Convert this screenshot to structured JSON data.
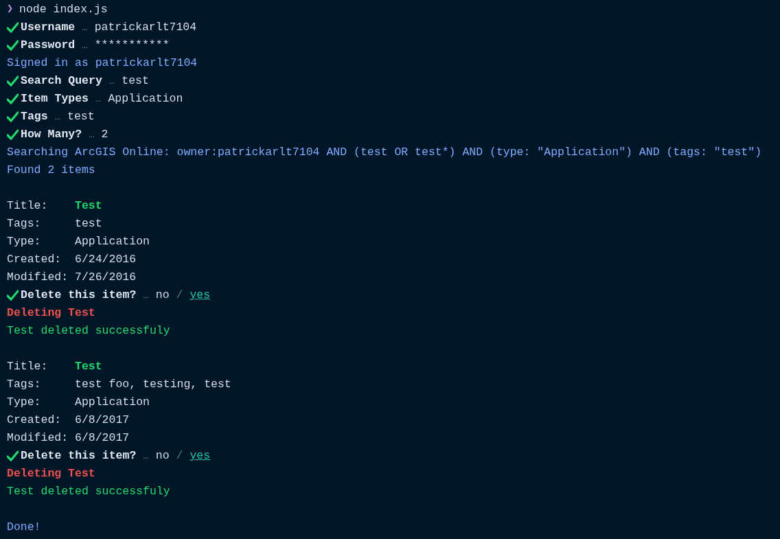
{
  "lines": [
    {
      "kind": "command",
      "prompt": "❯",
      "text": "node index.js"
    },
    {
      "kind": "question",
      "label": "Username",
      "ellipsis": "…",
      "answer": "patrickarlt7104"
    },
    {
      "kind": "question",
      "label": "Password",
      "ellipsis": "…",
      "answer": "***********"
    },
    {
      "kind": "info",
      "text": "Signed in as patrickarlt7104"
    },
    {
      "kind": "question",
      "label": "Search Query",
      "ellipsis": "…",
      "answer": "test"
    },
    {
      "kind": "question",
      "label": "Item Types",
      "ellipsis": "…",
      "answer": "Application"
    },
    {
      "kind": "question",
      "label": "Tags",
      "ellipsis": "…",
      "answer": "test"
    },
    {
      "kind": "question",
      "label": "How Many?",
      "ellipsis": "…",
      "answer": "2"
    },
    {
      "kind": "info",
      "text": "Searching ArcGIS Online: owner:patrickarlt7104 AND (test OR test*) AND (type: \"Application\") AND (tags: \"test\")"
    },
    {
      "kind": "info",
      "text": "Found 2 items"
    },
    {
      "kind": "blank"
    },
    {
      "kind": "field",
      "label": "Title:",
      "value": "Test",
      "highlight": true
    },
    {
      "kind": "field",
      "label": "Tags:",
      "value": "test",
      "highlight": false
    },
    {
      "kind": "field",
      "label": "Type:",
      "value": "Application",
      "highlight": false
    },
    {
      "kind": "field",
      "label": "Created:",
      "value": "6/24/2016",
      "highlight": false
    },
    {
      "kind": "field",
      "label": "Modified:",
      "value": "7/26/2016",
      "highlight": false
    },
    {
      "kind": "choice",
      "label": "Delete this item?",
      "ellipsis": "…",
      "separator": "/",
      "options": [
        {
          "label": "no",
          "selected": false
        },
        {
          "label": "yes",
          "selected": true
        }
      ]
    },
    {
      "kind": "error",
      "text": "Deleting Test"
    },
    {
      "kind": "success",
      "text": "Test deleted successfuly"
    },
    {
      "kind": "blank"
    },
    {
      "kind": "field",
      "label": "Title:",
      "value": "Test",
      "highlight": true
    },
    {
      "kind": "field",
      "label": "Tags:",
      "value": "test foo, testing, test",
      "highlight": false
    },
    {
      "kind": "field",
      "label": "Type:",
      "value": "Application",
      "highlight": false
    },
    {
      "kind": "field",
      "label": "Created:",
      "value": "6/8/2017",
      "highlight": false
    },
    {
      "kind": "field",
      "label": "Modified:",
      "value": "6/8/2017",
      "highlight": false
    },
    {
      "kind": "choice",
      "label": "Delete this item?",
      "ellipsis": "…",
      "separator": "/",
      "options": [
        {
          "label": "no",
          "selected": false
        },
        {
          "label": "yes",
          "selected": true
        }
      ]
    },
    {
      "kind": "error",
      "text": "Deleting Test"
    },
    {
      "kind": "success",
      "text": "Test deleted successfuly"
    },
    {
      "kind": "blank"
    },
    {
      "kind": "info",
      "text": "Done!"
    }
  ]
}
